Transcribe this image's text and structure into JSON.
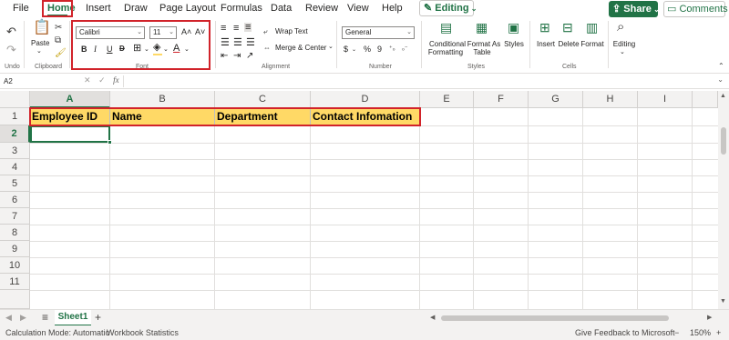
{
  "menu": {
    "tabs": [
      "File",
      "Home",
      "Insert",
      "Draw",
      "Page Layout",
      "Formulas",
      "Data",
      "Review",
      "View",
      "Help"
    ],
    "editing_label": "Editing",
    "share_label": "Share",
    "comments_label": "Comments"
  },
  "ribbon": {
    "undo_label": "Undo",
    "clipboard": {
      "paste_label": "Paste",
      "group_label": "Clipboard"
    },
    "font": {
      "font_name": "Calibri",
      "font_size": "11",
      "group_label": "Font",
      "bold": "B",
      "italic": "I",
      "underline": "U",
      "strike": "D",
      "grow": "A˄",
      "shrink": "A˅"
    },
    "alignment": {
      "wrap_text": "Wrap Text",
      "merge_center": "Merge & Center",
      "group_label": "Alignment"
    },
    "number": {
      "format": "General",
      "currency": "$",
      "percent": "%",
      "comma": "9",
      "group_label": "Number"
    },
    "styles": {
      "conditional": "Conditional",
      "conditional2": "Formatting",
      "format_as": "Format As",
      "format_as2": "Table",
      "styles_label": "Styles",
      "group_label": "Styles"
    },
    "cells": {
      "insert": "Insert",
      "delete": "Delete",
      "format": "Format",
      "group_label": "Cells"
    },
    "editing": {
      "label": "Editing"
    }
  },
  "formula_bar": {
    "name_box": "A2",
    "fx": "fx",
    "value": ""
  },
  "grid": {
    "columns": [
      "A",
      "B",
      "C",
      "D",
      "E",
      "F",
      "G",
      "H",
      "I"
    ],
    "rows": [
      "1",
      "2",
      "3",
      "4",
      "5",
      "6",
      "7",
      "8",
      "9",
      "10",
      "11"
    ],
    "header_cells": [
      "Employee ID",
      "Name",
      "Department",
      "Contact Infomation"
    ],
    "header_fill_color": "#ffd966",
    "active_cell": "A2"
  },
  "sheets": {
    "tabs": [
      "Sheet1"
    ],
    "add": "+"
  },
  "status": {
    "calc_mode": "Calculation Mode: Automatic",
    "workbook_stats": "Workbook Statistics",
    "feedback": "Give Feedback to Microsoft",
    "zoom_minus": "−",
    "zoom_level": "150%",
    "zoom_plus": "+"
  },
  "colors": {
    "accent": "#217346",
    "highlight": "#d1232a"
  }
}
